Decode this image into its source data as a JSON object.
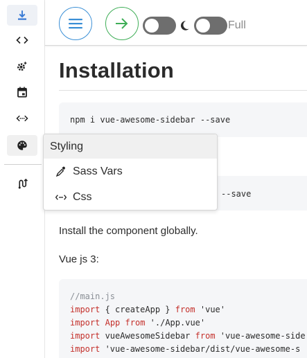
{
  "sidebar": {
    "items": [
      {
        "icon": "download-icon"
      },
      {
        "icon": "code-icon"
      },
      {
        "icon": "settings-icon"
      },
      {
        "icon": "calendar-icon"
      },
      {
        "icon": "code-dots-icon"
      },
      {
        "icon": "palette-icon"
      },
      {
        "icon": "route-icon"
      }
    ],
    "accent_color": "#3a7bd5"
  },
  "header": {
    "full_label": "Full",
    "menu_button_color": "#3a8fd6",
    "go_button_color": "#3fae57"
  },
  "submenu": {
    "title": "Styling",
    "items": [
      {
        "label": "Sass Vars",
        "icon": "eyedropper-icon"
      },
      {
        "label": "Css",
        "icon": "css-icon"
      }
    ]
  },
  "main": {
    "title": "Installation",
    "code1": "npm i vue-awesome-sidebar --save",
    "code2_visible": "--save",
    "para1": "Install the component globally.",
    "para2": "Vue js 3:",
    "code3": [
      {
        "parts": [
          {
            "t": "//main.js",
            "c": "comment"
          }
        ]
      },
      {
        "parts": [
          {
            "t": "import",
            "c": "kw"
          },
          {
            "t": " { createApp } ",
            "c": "str"
          },
          {
            "t": "from",
            "c": "kw"
          },
          {
            "t": " 'vue'",
            "c": "str"
          }
        ]
      },
      {
        "parts": [
          {
            "t": "import",
            "c": "kw"
          },
          {
            "t": " ",
            "c": "str"
          },
          {
            "t": "App",
            "c": "kw"
          },
          {
            "t": " ",
            "c": "str"
          },
          {
            "t": "from",
            "c": "kw"
          },
          {
            "t": " './App.vue'",
            "c": "str"
          }
        ]
      },
      {
        "parts": [
          {
            "t": "import",
            "c": "kw"
          },
          {
            "t": " vueAwesomeSidebar ",
            "c": "str"
          },
          {
            "t": "from",
            "c": "kw"
          },
          {
            "t": " 'vue-awesome-side",
            "c": "str"
          }
        ]
      },
      {
        "parts": [
          {
            "t": "import",
            "c": "kw"
          },
          {
            "t": " 'vue-awesome-sidebar/dist/vue-awesome-s",
            "c": "str"
          }
        ]
      }
    ]
  }
}
